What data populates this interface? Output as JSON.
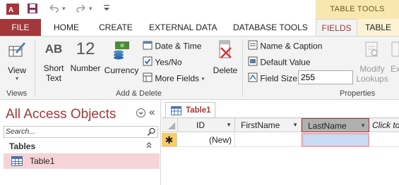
{
  "title_bar": {
    "context_tools": "TABLE TOOLS"
  },
  "tabs": [
    {
      "label": "FILE"
    },
    {
      "label": "HOME"
    },
    {
      "label": "CREATE"
    },
    {
      "label": "EXTERNAL DATA"
    },
    {
      "label": "DATABASE TOOLS"
    },
    {
      "label": "FIELDS"
    },
    {
      "label": "TABLE"
    }
  ],
  "ribbon": {
    "views": {
      "view_label": "View",
      "group_label": "Views"
    },
    "add_delete": {
      "short_text": "Short Text",
      "short_text_line1": "Short",
      "short_text_line2": "Text",
      "number": "Number",
      "number_icon_text": "12",
      "short_text_icon_text": "AB",
      "currency": "Currency",
      "date_time": "Date & Time",
      "yes_no": "Yes/No",
      "more_fields": "More Fields",
      "delete": "Delete",
      "group_label": "Add & Delete"
    },
    "properties": {
      "name_caption": "Name & Caption",
      "default_value": "Default Value",
      "field_size_label": "Field Size",
      "field_size_value": "255",
      "modify_lookups_line1": "Modify",
      "modify_lookups_line2": "Lookups",
      "modify_expr": "Ex",
      "group_label": "Properties"
    }
  },
  "nav_pane": {
    "title": "All Access Objects",
    "search_placeholder": "Search...",
    "section": "Tables",
    "items": [
      {
        "label": "Table1"
      }
    ]
  },
  "document": {
    "tab_label": "Table1",
    "columns": [
      {
        "label": "ID"
      },
      {
        "label": "FirstName"
      },
      {
        "label": "LastName"
      },
      {
        "label": "Click to"
      }
    ],
    "new_row": {
      "marker": "✱",
      "id": "(New)"
    }
  },
  "colors": {
    "accent": "#a4373a",
    "context_tab": "#f8e8b0",
    "selected_nav": "#f6d3d6"
  }
}
